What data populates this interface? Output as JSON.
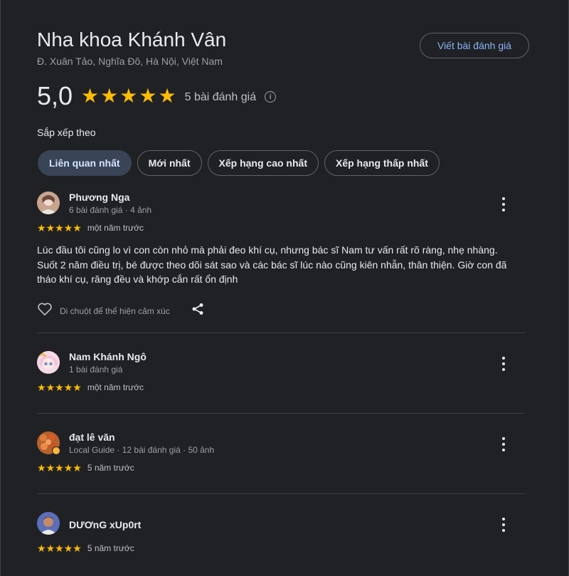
{
  "place": {
    "name": "Nha khoa Khánh Vân",
    "address": "Đ. Xuân Tảo, Nghĩa Đô, Hà Nội, Việt Nam",
    "write_review_label": "Viết bài đánh giá",
    "rating": "5,0",
    "stars": 5,
    "review_count": "5 bài đánh giá"
  },
  "sort": {
    "label": "Sắp xếp theo",
    "chips": [
      {
        "label": "Liên quan nhất",
        "active": true
      },
      {
        "label": "Mới nhất",
        "active": false
      },
      {
        "label": "Xếp hạng cao nhất",
        "active": false
      },
      {
        "label": "Xếp hạng thấp nhất",
        "active": false
      }
    ]
  },
  "reviews": [
    {
      "name": "Phương Nga",
      "meta": "6 bài đánh giá · 4 ảnh",
      "stars": 5,
      "date": "một năm trước",
      "text": "Lúc đầu tôi cũng lo vì con còn nhỏ mà phải đeo khí cụ, nhưng bác sĩ Nam tư vấn rất rõ ràng, nhẹ nhàng. Suốt 2 năm điều trị, bé được theo dõi sát sao và các bác sĩ lúc nào cũng kiên nhẫn, thân thiện. Giờ con đã tháo khí cụ, răng đều và khớp cắn rất ổn định",
      "reaction_hint": "Di chuột để thể hiện cảm xúc"
    },
    {
      "name": "Nam Khánh Ngô",
      "meta": "1 bài đánh giá",
      "stars": 5,
      "date": "một năm trước"
    },
    {
      "name": "đạt lê văn",
      "meta": "Local Guide · 12 bài đánh giá · 50 ảnh",
      "stars": 5,
      "date": "5 năm trước"
    },
    {
      "name": "DƯƠnG xUp0rt",
      "meta": "",
      "stars": 5,
      "date": "5 năm trước"
    }
  ],
  "colors": {
    "background": "#202124",
    "star": "#fbbc04",
    "link": "#8ab4f8",
    "active_chip": "#394457"
  }
}
